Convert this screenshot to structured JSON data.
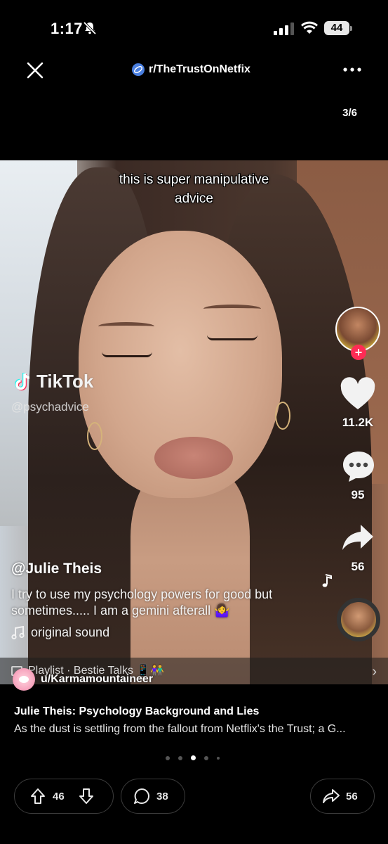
{
  "status_bar": {
    "time": "1:17",
    "battery": "44"
  },
  "top_bar": {
    "subreddit": "r/TheTrustOnNetfix",
    "counter": "3/6"
  },
  "video": {
    "caption_line1": "this is super manipulative",
    "caption_line2": "advice",
    "watermark_brand": "TikTok",
    "watermark_handle": "@psychadvice",
    "likes": "11.2K",
    "comments": "95",
    "shares": "56",
    "author": "@Julie Theis",
    "description": "I try to use my psychology powers for good but sometimes..... I am a gemini afterall 🤷‍♀️",
    "sound": "original sound",
    "playlist": "Playlist · Bestie Talks 📱👫"
  },
  "post": {
    "username": "u/Karmamountaineer",
    "title": "Julie Theis: Psychology Background and Lies",
    "body": "As the dust is settling from the fallout from Netflix's the Trust; a G..."
  },
  "actions": {
    "upvotes": "46",
    "comments": "38",
    "shares": "56"
  },
  "pagination": {
    "total_dots": 5,
    "active_index": 2
  },
  "colors": {
    "background": "#000000",
    "tiktok_red": "#fe2c55",
    "subreddit_blue": "#4a7fe0"
  }
}
